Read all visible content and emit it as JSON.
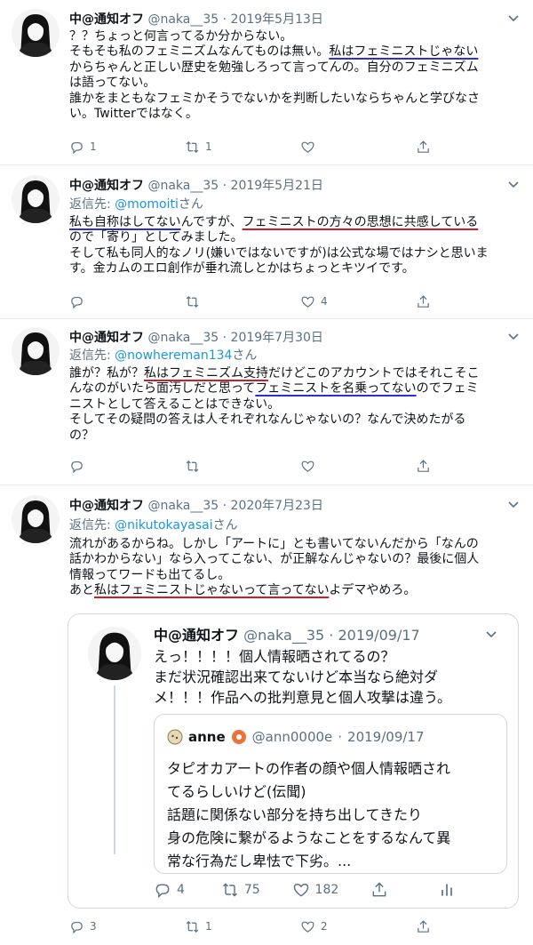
{
  "colors": {
    "text": "#0f1419",
    "muted": "#5b7083",
    "link": "#1b95e0",
    "underline_blue": "#2a2fd6",
    "underline_red": "#d01b2a"
  },
  "tweets": [
    {
      "name": "中@通知オフ",
      "handle": "@naka__35",
      "date": "2019年5月13日",
      "body": [
        [
          {
            "t": "？？ちょっと何言ってるか分からない。"
          }
        ],
        [
          {
            "t": "そもそも私のフェミニズムなんてものは無い。"
          },
          {
            "t": "私はフェミニストじゃない",
            "u": "blue"
          }
        ],
        [
          {
            "t": "からちゃんと正しい歴史を勉強しろって言ってんの。自分のフェミニズム"
          }
        ],
        [
          {
            "t": "は語ってない。"
          }
        ],
        [
          {
            "t": "誰かをまともなフェミかそうでないかを判断したいならちゃんと学びなさ"
          }
        ],
        [
          {
            "t": "い。Twitterではなく。"
          }
        ]
      ],
      "counts": {
        "reply": "1",
        "retweet": "1",
        "like": "",
        "share": ""
      }
    },
    {
      "name": "中@通知オフ",
      "handle": "@naka__35",
      "date": "2019年5月21日",
      "reply_label": "返信先: ",
      "reply_handle": "@momoiti",
      "reply_suffix": "さん",
      "body": [
        [
          {
            "t": "私も自称はしてない",
            "u": "blue"
          },
          {
            "t": "んですが、"
          },
          {
            "t": "フェミニストの方々の思想に共感している",
            "u": "red"
          }
        ],
        [
          {
            "t": "ので「寄り」としてみました。"
          }
        ],
        [
          {
            "t": "そして私も同人的なノリ(嫌いではないですが)は公式な場ではナシと思いま"
          }
        ],
        [
          {
            "t": "す。金カムのエロ創作が垂れ流しとかはちょっとキツイです。"
          }
        ]
      ],
      "counts": {
        "reply": "",
        "retweet": "",
        "like": "4",
        "share": ""
      }
    },
    {
      "name": "中@通知オフ",
      "handle": "@naka__35",
      "date": "2019年7月30日",
      "reply_label": "返信先: ",
      "reply_handle": "@nowhereman134",
      "reply_suffix": "さん",
      "body": [
        [
          {
            "t": "誰が？私が？"
          },
          {
            "t": "私はフェミニズム支持",
            "u": "red"
          },
          {
            "t": "だけどこのアカウントではそれこそこ"
          }
        ],
        [
          {
            "t": "んなのがいたら面汚しだと思って"
          },
          {
            "t": "フェミニストを名乗ってない",
            "u": "blue"
          },
          {
            "t": "のでフェミ"
          }
        ],
        [
          {
            "t": "ニストとして答えることはできない。"
          }
        ],
        [
          {
            "t": "そしてその疑問の答えは人それぞれなんじゃないの？なんで決めたがる"
          }
        ],
        [
          {
            "t": "の？"
          }
        ]
      ],
      "counts": {
        "reply": "",
        "retweet": "",
        "like": "",
        "share": ""
      }
    },
    {
      "name": "中@通知オフ",
      "handle": "@naka__35",
      "date": "2020年7月23日",
      "reply_label": "返信先: ",
      "reply_handle": "@nikutokayasai",
      "reply_suffix": "さん",
      "body": [
        [
          {
            "t": "流れがあるからね。しかし「アートに」とも書いてないんだから「なんの"
          }
        ],
        [
          {
            "t": "話かわからない」なら入ってこない、が正解なんじゃないの？最後に個人"
          }
        ],
        [
          {
            "t": "情報ってワードも出てるし。"
          }
        ],
        [
          {
            "t": "あと"
          },
          {
            "t": "私はフェミニストじゃないって言ってない",
            "u": "red"
          },
          {
            "t": "よデマやめろ。"
          }
        ]
      ],
      "counts": {
        "reply": "3",
        "retweet": "1",
        "like": "2",
        "share": ""
      }
    }
  ],
  "quote": {
    "name": "中@通知オフ",
    "handle": "@naka__35",
    "date": "2019/09/17",
    "body": [
      "えっ！！！！個人情報晒されてるの？",
      "まだ状況確認出来てないけど本当なら絶対ダ",
      "メ！！！作品への批判意見と個人攻撃は違う。"
    ],
    "inner": {
      "name": "anne",
      "handle": "@ann0000e",
      "date": "2019/09/17",
      "body": [
        "タピオカアートの作者の顔や個人情報晒され",
        "てるらしいけど(伝聞)",
        "話題に関係ない部分を持ち出してきたり",
        "身の危険に繋がるようなことをするなんて異",
        "常な行為だし卑怯で下劣。..."
      ]
    },
    "counts": {
      "reply": "4",
      "retweet": "75",
      "like": "182"
    }
  }
}
